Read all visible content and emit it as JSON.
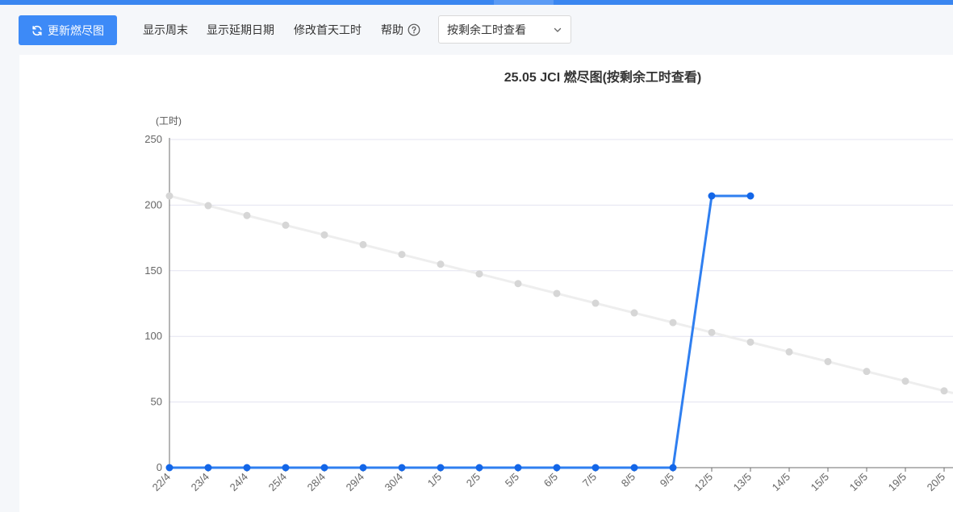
{
  "toolbar": {
    "refresh_label": "更新燃尽图",
    "show_weekend": "显示周末",
    "show_delay": "显示延期日期",
    "edit_first_day": "修改首天工时",
    "help": "帮助",
    "view_mode_selected": "按剩余工时查看"
  },
  "colors": {
    "primary": "#3d8af7",
    "actual_line": "#2f7ff0",
    "ideal_line": "#eeeeee",
    "ideal_point": "#d6d6d6"
  },
  "icons": {
    "refresh": "refresh-icon",
    "help": "help-circle-icon",
    "dropdown": "chevron-down-icon"
  },
  "chart_data": {
    "type": "line",
    "title": "25.05 JCI 燃尽图(按剩余工时查看)",
    "ylabel": "(工时)",
    "ylim": [
      0,
      250
    ],
    "yticks": [
      0,
      50,
      100,
      150,
      200,
      250
    ],
    "grid": true,
    "categories": [
      "22/4",
      "23/4",
      "24/4",
      "25/4",
      "28/4",
      "29/4",
      "30/4",
      "1/5",
      "2/5",
      "5/5",
      "6/5",
      "7/5",
      "8/5",
      "9/5",
      "12/5",
      "13/5",
      "14/5",
      "15/5",
      "16/5",
      "19/5",
      "20/5"
    ],
    "series": [
      {
        "key": "ideal",
        "values": [
          207,
          199.6,
          192.1,
          184.7,
          177.3,
          169.9,
          162.4,
          155.0,
          147.6,
          140.2,
          132.7,
          125.3,
          117.9,
          110.5,
          103.0,
          95.6,
          88.2,
          80.8,
          73.3,
          65.9,
          58.5
        ]
      },
      {
        "key": "actual",
        "values": [
          0,
          0,
          0,
          0,
          0,
          0,
          0,
          0,
          0,
          0,
          0,
          0,
          0,
          0,
          207,
          207
        ]
      }
    ]
  }
}
